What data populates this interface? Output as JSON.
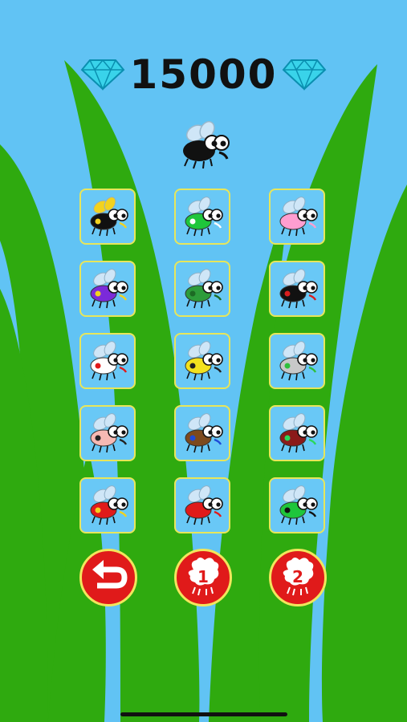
{
  "score": {
    "value": "15000",
    "left_icon": "diamond-icon",
    "right_icon": "diamond-icon"
  },
  "selected_fly": {
    "icon": "black-fly-icon",
    "body_color": "#111111"
  },
  "skins": [
    {
      "name": "yellow-black-fly",
      "body": "#111111",
      "wing": "#f3d21e",
      "accent": "#f3d21e"
    },
    {
      "name": "green-party-fly",
      "body": "#1fc63b",
      "wing": "#cfe6f7",
      "accent": "#ffffff"
    },
    {
      "name": "pink-fly",
      "body": "#ff9ed0",
      "wing": "#cfe6f7",
      "accent": "#ff9ed0"
    },
    {
      "name": "purple-crown-fly",
      "body": "#7b2ad9",
      "wing": "#cfe6f7",
      "accent": "#f3d21e"
    },
    {
      "name": "green-spotted-fly",
      "body": "#2d9c3a",
      "wing": "#cfe6f7",
      "accent": "#1c6a24"
    },
    {
      "name": "black-red-fly",
      "body": "#111111",
      "wing": "#cfe6f7",
      "accent": "#d81e1e"
    },
    {
      "name": "medic-fly",
      "body": "#ffffff",
      "wing": "#cfe6f7",
      "accent": "#e01a1a"
    },
    {
      "name": "radioactive-fly",
      "body": "#f3e21e",
      "wing": "#cfe6f7",
      "accent": "#222222"
    },
    {
      "name": "grey-recycle-fly",
      "body": "#c8c8c8",
      "wing": "#cfe6f7",
      "accent": "#2fbf3c"
    },
    {
      "name": "pink-top-hat-fly",
      "body": "#f7b9b3",
      "wing": "#cfe6f7",
      "accent": "#222222"
    },
    {
      "name": "brown-cap-fly",
      "body": "#7d4a1e",
      "wing": "#cfe6f7",
      "accent": "#1e4ad8"
    },
    {
      "name": "maroon-feather-fly",
      "body": "#8b1a1a",
      "wing": "#cfe6f7",
      "accent": "#2ad85a"
    },
    {
      "name": "red-lightning-fly",
      "body": "#e01a1a",
      "wing": "#cfe6f7",
      "accent": "#f3d21e"
    },
    {
      "name": "red-fly",
      "body": "#e01a1a",
      "wing": "#cfe6f7",
      "accent": "#e01a1a"
    },
    {
      "name": "green-angry-fly",
      "body": "#1fc63b",
      "wing": "#cfe6f7",
      "accent": "#111111"
    }
  ],
  "buttons": {
    "back": {
      "icon": "undo-arrow-icon"
    },
    "pack1": {
      "icon": "fly-pack-icon",
      "label": "1"
    },
    "pack2": {
      "icon": "fly-pack-icon",
      "label": "2"
    }
  },
  "colors": {
    "sky": "#61c3f4",
    "grass": "#2faa0f",
    "tile_bg": "#69c8f6",
    "tile_border": "#e8e65a",
    "button_red": "#e01a1a"
  }
}
